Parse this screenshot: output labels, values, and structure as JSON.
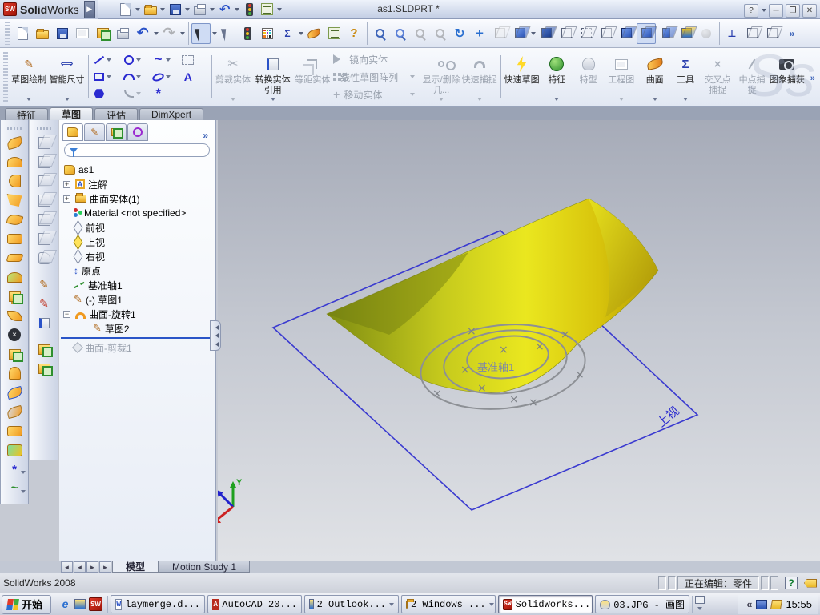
{
  "colors": {
    "accent_blue": "#2a2ad0",
    "plane_blue": "#3a3ad0",
    "surface_yellow": "#e6e41f",
    "sw_red": "#b82a1e"
  },
  "icons": {
    "sw_mark": "SW",
    "undo": "↶",
    "redo": "↷",
    "chevron_right": "»",
    "chevron_left": "«",
    "help": "?",
    "sigma": "Σ",
    "text_tool": "A",
    "point_tool": "*",
    "spline_tool": "~",
    "cross": "×",
    "pan_plus": "+",
    "pencil": "✎",
    "delete_x": "×",
    "ie": "e",
    "word": "W",
    "autocad": "A",
    "move": "+",
    "arrow_left": "◄",
    "arrow_right": "►",
    "arrow_first": "|◄",
    "arrow_last": "►|",
    "squiggle": "~",
    "watermark": "Ss"
  },
  "titlebar": {
    "logo_solid": "Solid",
    "logo_works": "Works",
    "title": "as1.SLDPRT *",
    "help": "?"
  },
  "cmd_tabs": {
    "items": [
      {
        "label": "特征"
      },
      {
        "label": "草图"
      },
      {
        "label": "评估"
      },
      {
        "label": "DimXpert"
      }
    ],
    "active": "草图"
  },
  "ribbon": {
    "buttons": [
      {
        "label": "草图绘制",
        "enabled": true
      },
      {
        "label": "智能尺寸",
        "enabled": true
      },
      {
        "label": "剪裁实体",
        "enabled": false
      },
      {
        "label": "转换实体引用",
        "enabled": true
      },
      {
        "label": "等距实体",
        "enabled": false
      },
      {
        "label": "镜向实体",
        "enabled": false
      },
      {
        "label": "线性草图阵列",
        "enabled": false
      },
      {
        "label": "移动实体",
        "enabled": false
      },
      {
        "label": "显示/删除几...",
        "enabled": false
      },
      {
        "label": "快速捕捉",
        "enabled": false
      },
      {
        "label": "快速草图",
        "enabled": true
      },
      {
        "label": "特征",
        "enabled": true
      },
      {
        "label": "特型",
        "enabled": false
      },
      {
        "label": "工程图",
        "enabled": false
      },
      {
        "label": "曲面",
        "enabled": true
      },
      {
        "label": "工具",
        "enabled": true
      },
      {
        "label": "交叉点捕捉",
        "enabled": false
      },
      {
        "label": "中点捕捉",
        "enabled": false
      },
      {
        "label": "图象捕获",
        "enabled": true
      }
    ]
  },
  "tree": {
    "filter_value": "",
    "items": [
      {
        "label": "as1"
      },
      {
        "label": "注解"
      },
      {
        "label": "曲面实体(1)"
      },
      {
        "label": "Material <not specified>"
      },
      {
        "label": "前视"
      },
      {
        "label": "上视"
      },
      {
        "label": "右视"
      },
      {
        "label": "原点"
      },
      {
        "label": "基准轴1"
      },
      {
        "label": "(-) 草图1"
      },
      {
        "label": "曲面-旋转1"
      },
      {
        "label": "草图2"
      },
      {
        "label": "曲面-剪裁1"
      }
    ]
  },
  "viewport": {
    "axis_label": "基准轴1",
    "plane_label": "上视",
    "triad": {
      "x": "X",
      "y": "Y",
      "z": "Z"
    }
  },
  "model_tabs": {
    "items": [
      {
        "label": "模型"
      },
      {
        "label": "Motion Study 1"
      }
    ],
    "active": "模型"
  },
  "statusbar": {
    "app": "SolidWorks 2008",
    "editing": "正在编辑：零件",
    "help": "?"
  },
  "taskbar": {
    "start": "开始",
    "tasks": [
      {
        "label": "laymerge.d..."
      },
      {
        "label": "AutoCAD 20..."
      },
      {
        "label": "2 Outlook..."
      },
      {
        "label": "2 Windows ..."
      },
      {
        "label": "SolidWorks..."
      },
      {
        "label": "03.JPG - 画图"
      }
    ],
    "time": "15:55"
  }
}
